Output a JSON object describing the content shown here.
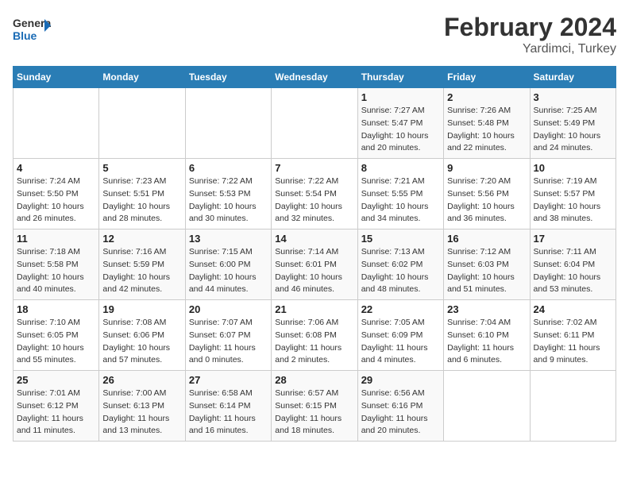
{
  "header": {
    "logo_line1": "General",
    "logo_line2": "Blue",
    "title": "February 2024",
    "subtitle": "Yardimci, Turkey"
  },
  "days_of_week": [
    "Sunday",
    "Monday",
    "Tuesday",
    "Wednesday",
    "Thursday",
    "Friday",
    "Saturday"
  ],
  "weeks": [
    [
      {
        "day": "",
        "details": ""
      },
      {
        "day": "",
        "details": ""
      },
      {
        "day": "",
        "details": ""
      },
      {
        "day": "",
        "details": ""
      },
      {
        "day": "1",
        "details": "Sunrise: 7:27 AM\nSunset: 5:47 PM\nDaylight: 10 hours and 20 minutes."
      },
      {
        "day": "2",
        "details": "Sunrise: 7:26 AM\nSunset: 5:48 PM\nDaylight: 10 hours and 22 minutes."
      },
      {
        "day": "3",
        "details": "Sunrise: 7:25 AM\nSunset: 5:49 PM\nDaylight: 10 hours and 24 minutes."
      }
    ],
    [
      {
        "day": "4",
        "details": "Sunrise: 7:24 AM\nSunset: 5:50 PM\nDaylight: 10 hours and 26 minutes."
      },
      {
        "day": "5",
        "details": "Sunrise: 7:23 AM\nSunset: 5:51 PM\nDaylight: 10 hours and 28 minutes."
      },
      {
        "day": "6",
        "details": "Sunrise: 7:22 AM\nSunset: 5:53 PM\nDaylight: 10 hours and 30 minutes."
      },
      {
        "day": "7",
        "details": "Sunrise: 7:22 AM\nSunset: 5:54 PM\nDaylight: 10 hours and 32 minutes."
      },
      {
        "day": "8",
        "details": "Sunrise: 7:21 AM\nSunset: 5:55 PM\nDaylight: 10 hours and 34 minutes."
      },
      {
        "day": "9",
        "details": "Sunrise: 7:20 AM\nSunset: 5:56 PM\nDaylight: 10 hours and 36 minutes."
      },
      {
        "day": "10",
        "details": "Sunrise: 7:19 AM\nSunset: 5:57 PM\nDaylight: 10 hours and 38 minutes."
      }
    ],
    [
      {
        "day": "11",
        "details": "Sunrise: 7:18 AM\nSunset: 5:58 PM\nDaylight: 10 hours and 40 minutes."
      },
      {
        "day": "12",
        "details": "Sunrise: 7:16 AM\nSunset: 5:59 PM\nDaylight: 10 hours and 42 minutes."
      },
      {
        "day": "13",
        "details": "Sunrise: 7:15 AM\nSunset: 6:00 PM\nDaylight: 10 hours and 44 minutes."
      },
      {
        "day": "14",
        "details": "Sunrise: 7:14 AM\nSunset: 6:01 PM\nDaylight: 10 hours and 46 minutes."
      },
      {
        "day": "15",
        "details": "Sunrise: 7:13 AM\nSunset: 6:02 PM\nDaylight: 10 hours and 48 minutes."
      },
      {
        "day": "16",
        "details": "Sunrise: 7:12 AM\nSunset: 6:03 PM\nDaylight: 10 hours and 51 minutes."
      },
      {
        "day": "17",
        "details": "Sunrise: 7:11 AM\nSunset: 6:04 PM\nDaylight: 10 hours and 53 minutes."
      }
    ],
    [
      {
        "day": "18",
        "details": "Sunrise: 7:10 AM\nSunset: 6:05 PM\nDaylight: 10 hours and 55 minutes."
      },
      {
        "day": "19",
        "details": "Sunrise: 7:08 AM\nSunset: 6:06 PM\nDaylight: 10 hours and 57 minutes."
      },
      {
        "day": "20",
        "details": "Sunrise: 7:07 AM\nSunset: 6:07 PM\nDaylight: 11 hours and 0 minutes."
      },
      {
        "day": "21",
        "details": "Sunrise: 7:06 AM\nSunset: 6:08 PM\nDaylight: 11 hours and 2 minutes."
      },
      {
        "day": "22",
        "details": "Sunrise: 7:05 AM\nSunset: 6:09 PM\nDaylight: 11 hours and 4 minutes."
      },
      {
        "day": "23",
        "details": "Sunrise: 7:04 AM\nSunset: 6:10 PM\nDaylight: 11 hours and 6 minutes."
      },
      {
        "day": "24",
        "details": "Sunrise: 7:02 AM\nSunset: 6:11 PM\nDaylight: 11 hours and 9 minutes."
      }
    ],
    [
      {
        "day": "25",
        "details": "Sunrise: 7:01 AM\nSunset: 6:12 PM\nDaylight: 11 hours and 11 minutes."
      },
      {
        "day": "26",
        "details": "Sunrise: 7:00 AM\nSunset: 6:13 PM\nDaylight: 11 hours and 13 minutes."
      },
      {
        "day": "27",
        "details": "Sunrise: 6:58 AM\nSunset: 6:14 PM\nDaylight: 11 hours and 16 minutes."
      },
      {
        "day": "28",
        "details": "Sunrise: 6:57 AM\nSunset: 6:15 PM\nDaylight: 11 hours and 18 minutes."
      },
      {
        "day": "29",
        "details": "Sunrise: 6:56 AM\nSunset: 6:16 PM\nDaylight: 11 hours and 20 minutes."
      },
      {
        "day": "",
        "details": ""
      },
      {
        "day": "",
        "details": ""
      }
    ]
  ]
}
